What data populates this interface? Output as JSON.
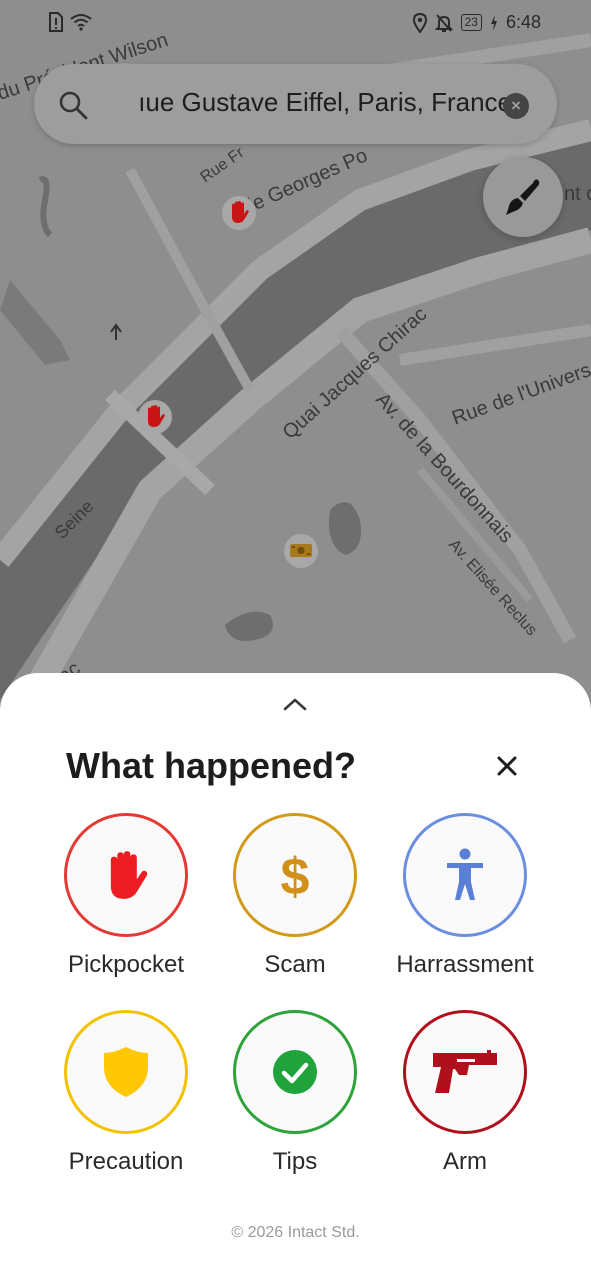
{
  "status_bar": {
    "battery": "23",
    "time": "6:48"
  },
  "map": {
    "labels": {
      "avenue_president_wilson": "du Président Wilson",
      "rue_fresnel": "Rue Fr",
      "quai_georges": "ie Georges Po",
      "quai_jacques_chirac": "Quai Jacques Chirac",
      "rue_universite": "Rue de l'Univers",
      "av_bourdonnais": "Av. de la Bourdonnais",
      "av_elisee_reclus": "Av. Elisée Reclus",
      "seine": "Seine",
      "chirac_bottom": "irac",
      "right_edge": "nt c"
    },
    "markers": [
      "pickpocket",
      "pickpocket",
      "scam"
    ]
  },
  "search": {
    "value": "ıue Gustave Eiffel, Paris, France",
    "clear_label": "×"
  },
  "sheet": {
    "title": "What happened?",
    "close_label": "×",
    "categories": [
      {
        "label": "Pickpocket",
        "icon": "hand-stop-icon",
        "color": "#e53935"
      },
      {
        "label": "Scam",
        "icon": "dollar-icon",
        "color": "#d29a18"
      },
      {
        "label": "Harrassment",
        "icon": "person-icon",
        "color": "#6a8ee0"
      },
      {
        "label": "Precaution",
        "icon": "shield-icon",
        "color": "#f2c200"
      },
      {
        "label": "Tips",
        "icon": "check-circle-icon",
        "color": "#2fa33a"
      },
      {
        "label": "Arm",
        "icon": "gun-icon",
        "color": "#b0101c"
      }
    ]
  },
  "footer": {
    "text": "© 2026 Intact Std."
  }
}
